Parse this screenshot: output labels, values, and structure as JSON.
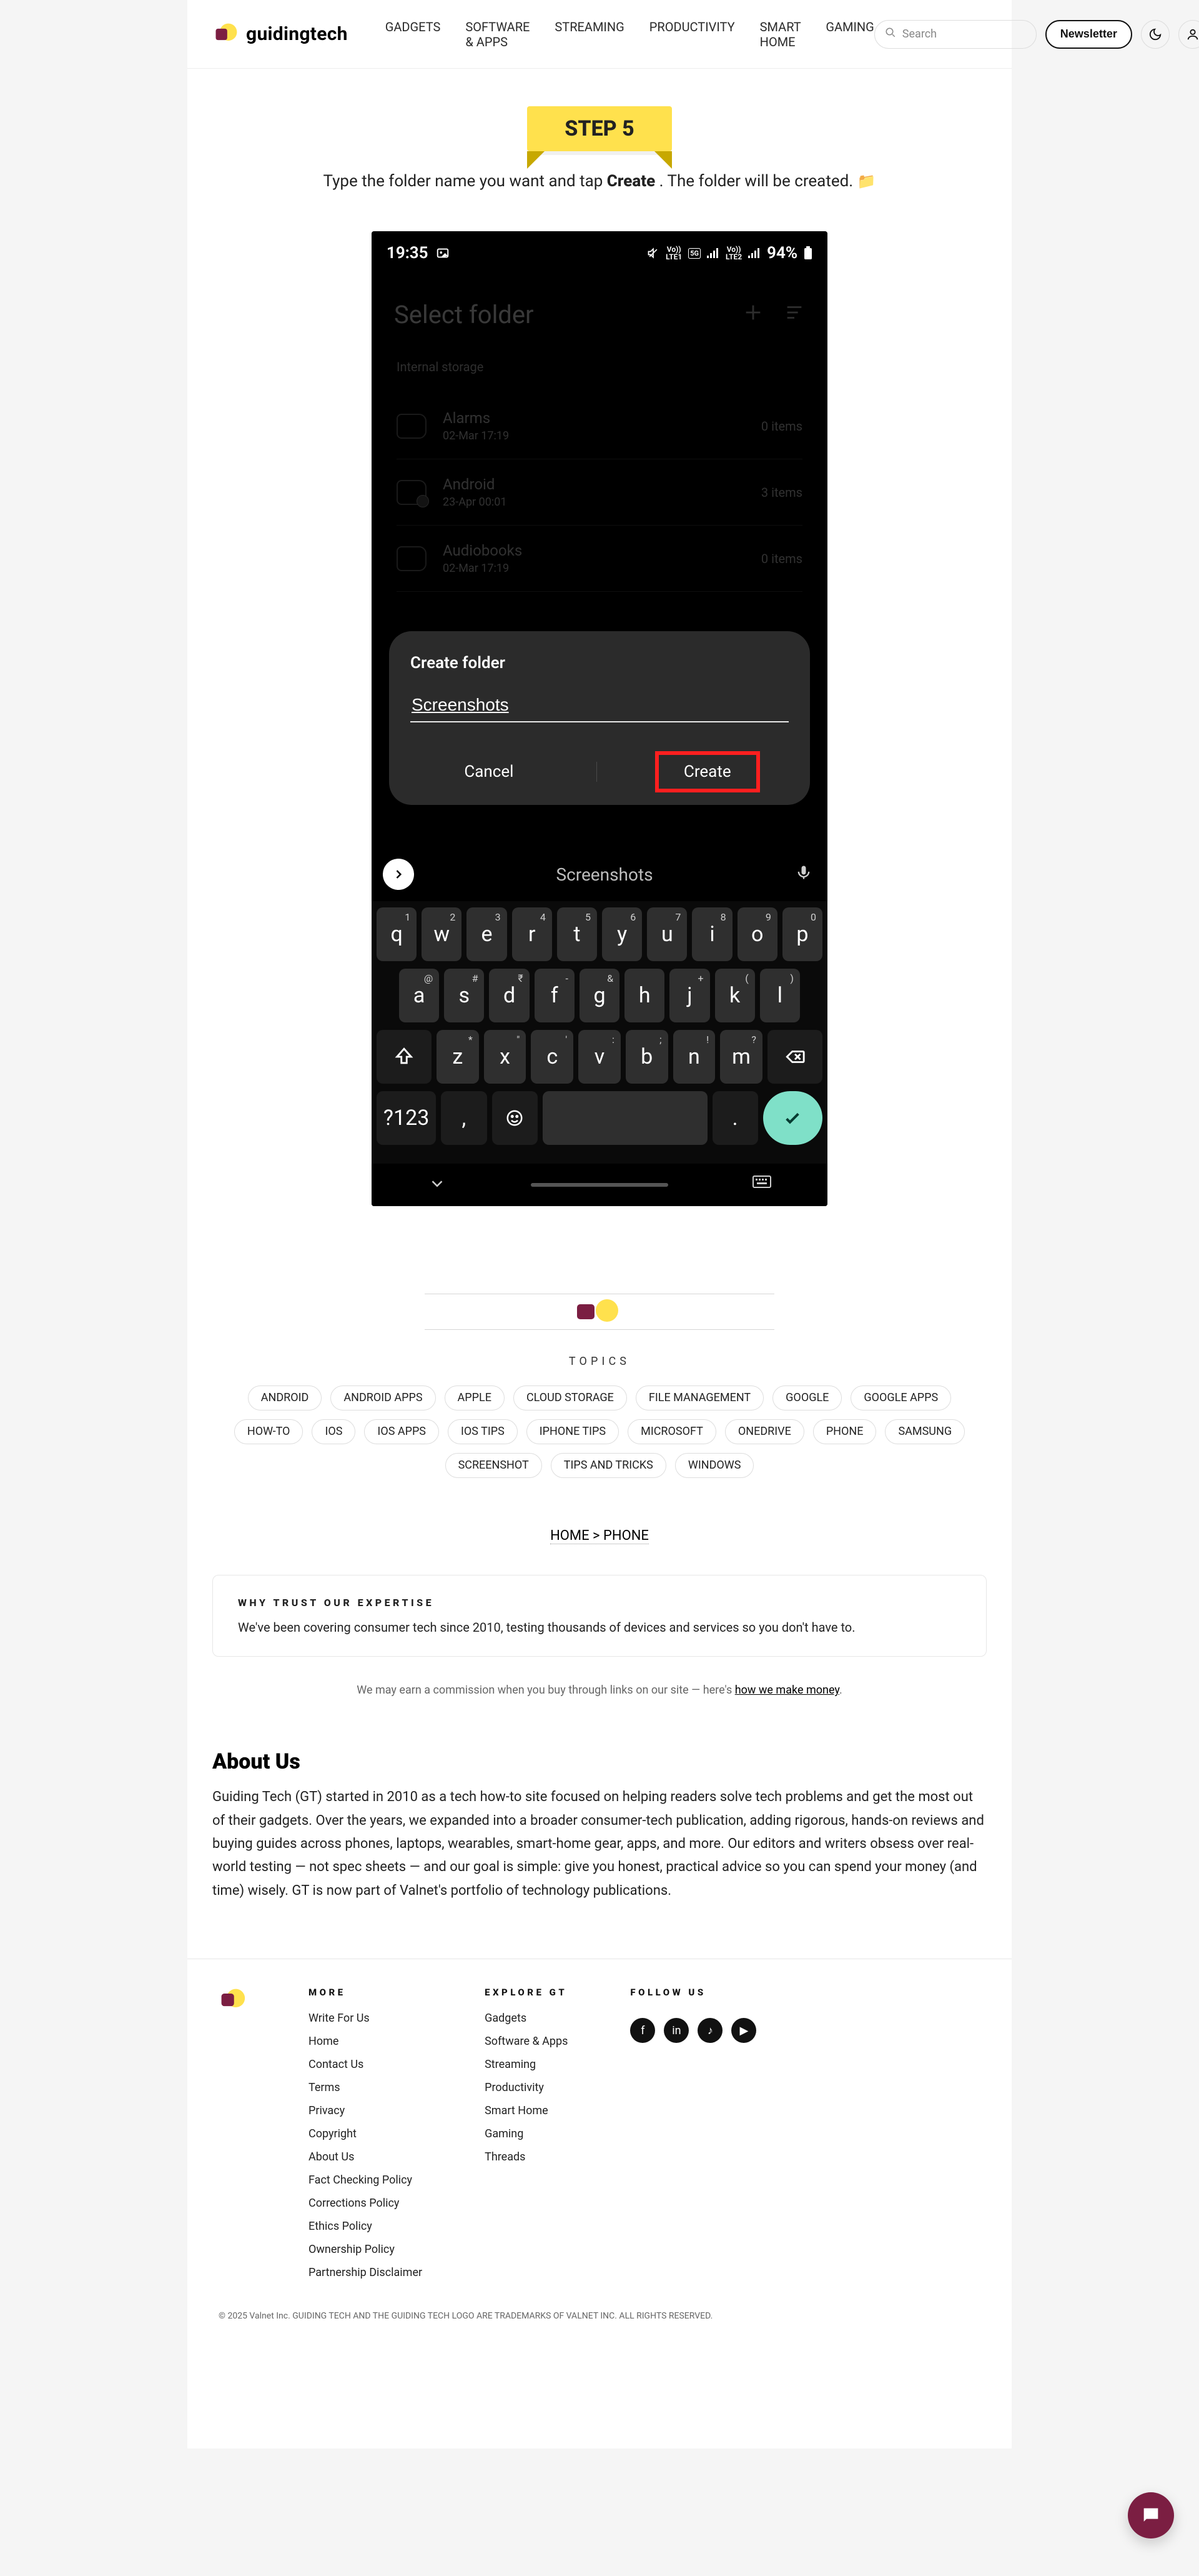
{
  "topbar": {
    "brand": "guidingtech",
    "nav": [
      "GADGETS",
      "SOFTWARE & APPS",
      "STREAMING",
      "PRODUCTIVITY",
      "SMART HOME",
      "GAMING"
    ],
    "search_placeholder": "Search",
    "newsletter": "Newsletter"
  },
  "step": {
    "ribbon": "STEP 5",
    "line_prefix": "Type the folder name you want and tap ",
    "line_bold": "Create",
    "line_suffix": ". The folder will be created. "
  },
  "phone": {
    "status": {
      "time": "19:35",
      "battery": "94%"
    },
    "bg": {
      "title": "Select folder",
      "breadcrumb": "Internal storage",
      "rows": [
        {
          "name": "Alarms",
          "date": "02-Mar 17:19",
          "count": "0 items",
          "cfg": false
        },
        {
          "name": "Android",
          "date": "23-Apr 00:01",
          "count": "3 items",
          "cfg": true
        },
        {
          "name": "Audiobooks",
          "date": "02-Mar 17:19",
          "count": "0 items",
          "cfg": false
        }
      ]
    },
    "modal": {
      "title": "Create folder",
      "value": "Screenshots",
      "cancel": "Cancel",
      "create": "Create"
    },
    "suggestion": "Screenshots",
    "keys_r1": [
      {
        "k": "q",
        "s": "1"
      },
      {
        "k": "w",
        "s": "2"
      },
      {
        "k": "e",
        "s": "3"
      },
      {
        "k": "r",
        "s": "4"
      },
      {
        "k": "t",
        "s": "5"
      },
      {
        "k": "y",
        "s": "6"
      },
      {
        "k": "u",
        "s": "7"
      },
      {
        "k": "i",
        "s": "8"
      },
      {
        "k": "o",
        "s": "9"
      },
      {
        "k": "p",
        "s": "0"
      }
    ],
    "keys_r2": [
      {
        "k": "a",
        "s": "@"
      },
      {
        "k": "s",
        "s": "#"
      },
      {
        "k": "d",
        "s": "₹"
      },
      {
        "k": "f",
        "s": "-"
      },
      {
        "k": "g",
        "s": "&"
      },
      {
        "k": "h",
        "s": ""
      },
      {
        "k": "j",
        "s": "+"
      },
      {
        "k": "k",
        "s": "("
      },
      {
        "k": "l",
        "s": ")"
      }
    ],
    "keys_r3": [
      {
        "k": "z",
        "s": "*"
      },
      {
        "k": "x",
        "s": "\""
      },
      {
        "k": "c",
        "s": "'"
      },
      {
        "k": "v",
        "s": ":"
      },
      {
        "k": "b",
        "s": ";"
      },
      {
        "k": "n",
        "s": "!"
      },
      {
        "k": "m",
        "s": "?"
      }
    ],
    "sym_key": "?123",
    "comma": ",",
    "period": "."
  },
  "topics_heading": "TOPICS",
  "topics": [
    "ANDROID",
    "ANDROID APPS",
    "APPLE",
    "CLOUD STORAGE",
    "FILE MANAGEMENT",
    "GOOGLE",
    "GOOGLE APPS",
    "HOW-TO",
    "IOS",
    "IOS APPS",
    "IOS TIPS",
    "IPHONE TIPS",
    "MICROSOFT",
    "ONEDRIVE",
    "PHONE",
    "SAMSUNG",
    "SCREENSHOT",
    "TIPS AND TRICKS",
    "WINDOWS"
  ],
  "home_link": "HOME  >  PHONE",
  "meta": {
    "expertise_heading": "WHY TRUST OUR EXPERTISE",
    "expertise_text": "We've been covering consumer tech since 2010, testing thousands of devices and services so you don't have to.",
    "disclosure": "We may earn a commission when you buy through links on our site — here's ",
    "disclosure_link": "how we make money"
  },
  "about": {
    "heading": "About Us",
    "text": "Guiding Tech (GT) started in 2010 as a tech how-to site focused on helping readers solve tech problems and get the most out of their gadgets. Over the years, we expanded into a broader consumer-tech publication, adding rigorous, hands-on reviews and buying guides across phones, laptops, wearables, smart-home gear, apps, and more. Our editors and writers obsess over real-world testing — not spec sheets — and our goal is simple: give you honest, practical advice so you can spend your money (and time) wisely. GT is now part of Valnet's portfolio of technology publications."
  },
  "footer": {
    "cols": [
      {
        "h": "MORE",
        "links": [
          "Write For Us",
          "Home",
          "Contact Us",
          "Terms",
          "Privacy",
          "Copyright",
          "About Us",
          "Fact Checking Policy",
          "Corrections Policy",
          "Ethics Policy",
          "Ownership Policy",
          "Partnership Disclaimer"
        ]
      },
      {
        "h": "EXPLORE GT",
        "links": [
          "Gadgets",
          "Software & Apps",
          "Streaming",
          "Productivity",
          "Smart Home",
          "Gaming",
          "Threads"
        ]
      }
    ],
    "follow_h": "FOLLOW US",
    "socials": [
      "f",
      "in",
      "♪",
      "▶"
    ]
  },
  "legal": "© 2025 Valnet Inc. GUIDING TECH AND THE GUIDING TECH LOGO ARE TRADEMARKS OF VALNET INC. ALL RIGHTS RESERVED."
}
